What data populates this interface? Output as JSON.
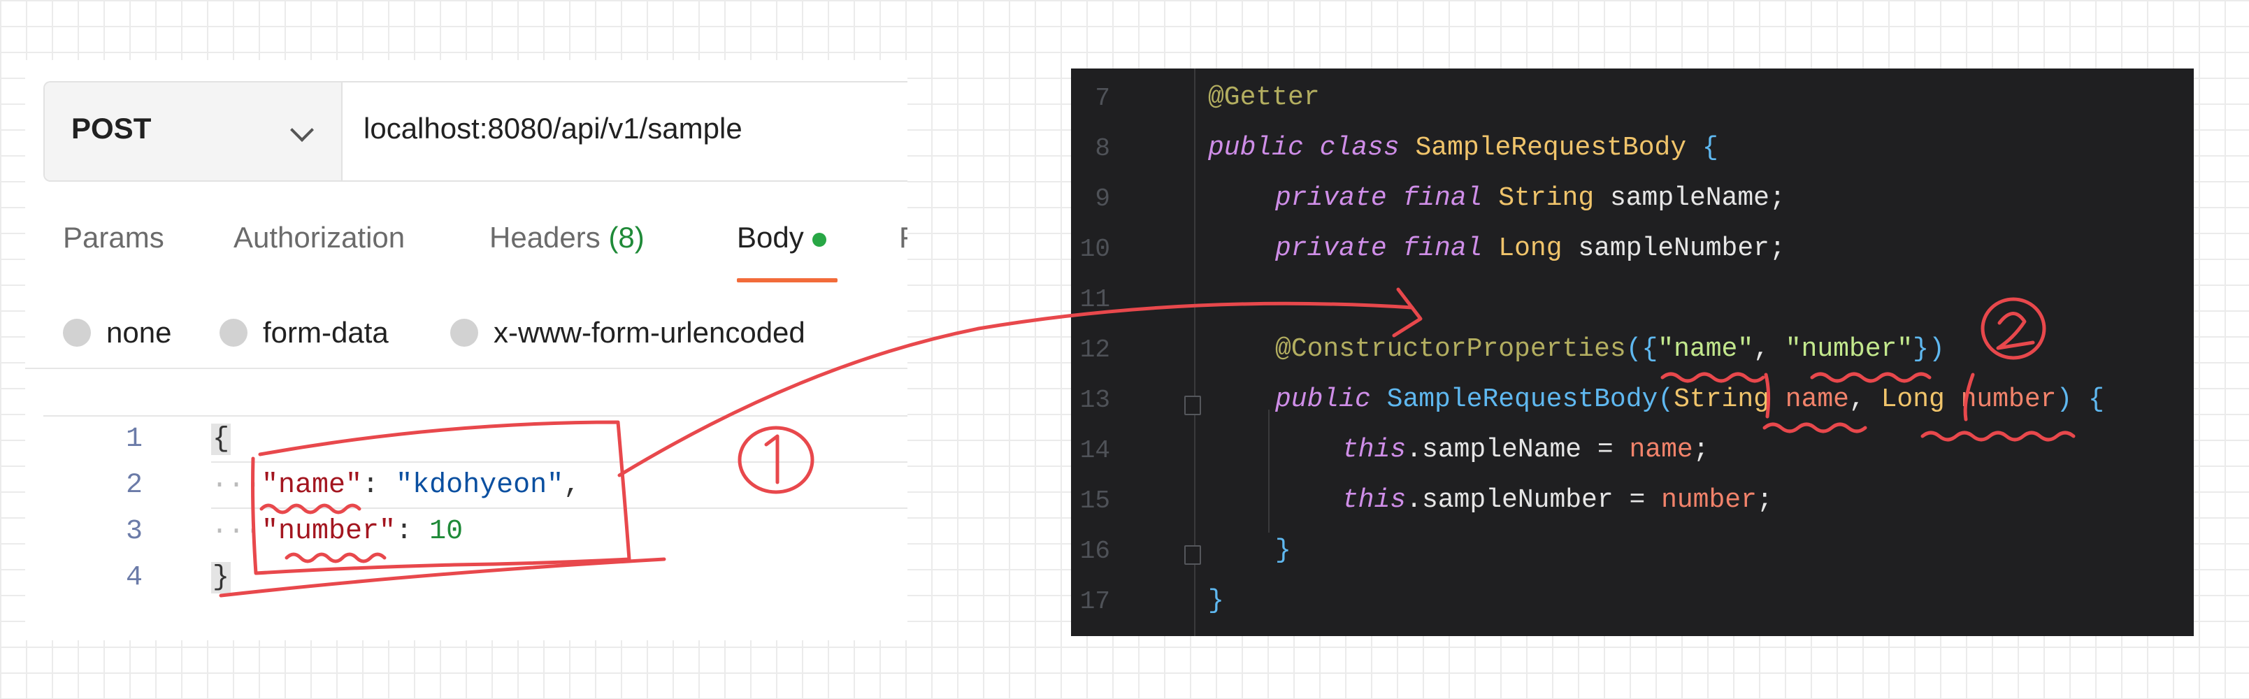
{
  "postman": {
    "method": "POST",
    "url": "localhost:8080/api/v1/sample",
    "tabs": {
      "params": "Params",
      "authorization": "Authorization",
      "headers": "Headers",
      "headers_count": "(8)",
      "body": "Body",
      "cut": "F"
    },
    "body_types": {
      "none": "none",
      "form_data": "form-data",
      "urlencoded": "x-www-form-urlencoded"
    },
    "editor": {
      "line_numbers": [
        "1",
        "2",
        "3",
        "4"
      ],
      "open_brace": "{",
      "close_brace": "}",
      "dots": "···",
      "key_name": "\"name\"",
      "value_name": "\"kdohyeon\"",
      "key_number": "\"number\"",
      "value_number": "10",
      "colon": ": ",
      "comma": ","
    }
  },
  "ide": {
    "line_numbers": [
      "7",
      "8",
      "9",
      "10",
      "11",
      "12",
      "13",
      "14",
      "15",
      "16",
      "17"
    ],
    "annotation_getter": "@Getter",
    "kw_public": "public",
    "kw_class": "class",
    "class_name": "SampleRequestBody",
    "open_brace": "{",
    "kw_private": "private",
    "kw_final": "final",
    "type_string": "String",
    "type_long": "Long",
    "field_name": "sampleName;",
    "field_number": "sampleNumber;",
    "annotation_ctor": "@ConstructorProperties",
    "ctor_open": "({",
    "ctor_str_name": "\"name\"",
    "ctor_comma": ", ",
    "ctor_str_number": "\"number\"",
    "ctor_close": "})",
    "ctor_name": "SampleRequestBody",
    "param_name": "name",
    "param_number": "number",
    "kw_this": "this",
    "assign_name": ".sampleName = ",
    "assign_number": ".sampleNumber = ",
    "semicolon": ";",
    "close_brace": "}"
  },
  "annotations": {
    "circle_one": "1",
    "circle_two": "2",
    "stroke_color": "#e8484c"
  }
}
